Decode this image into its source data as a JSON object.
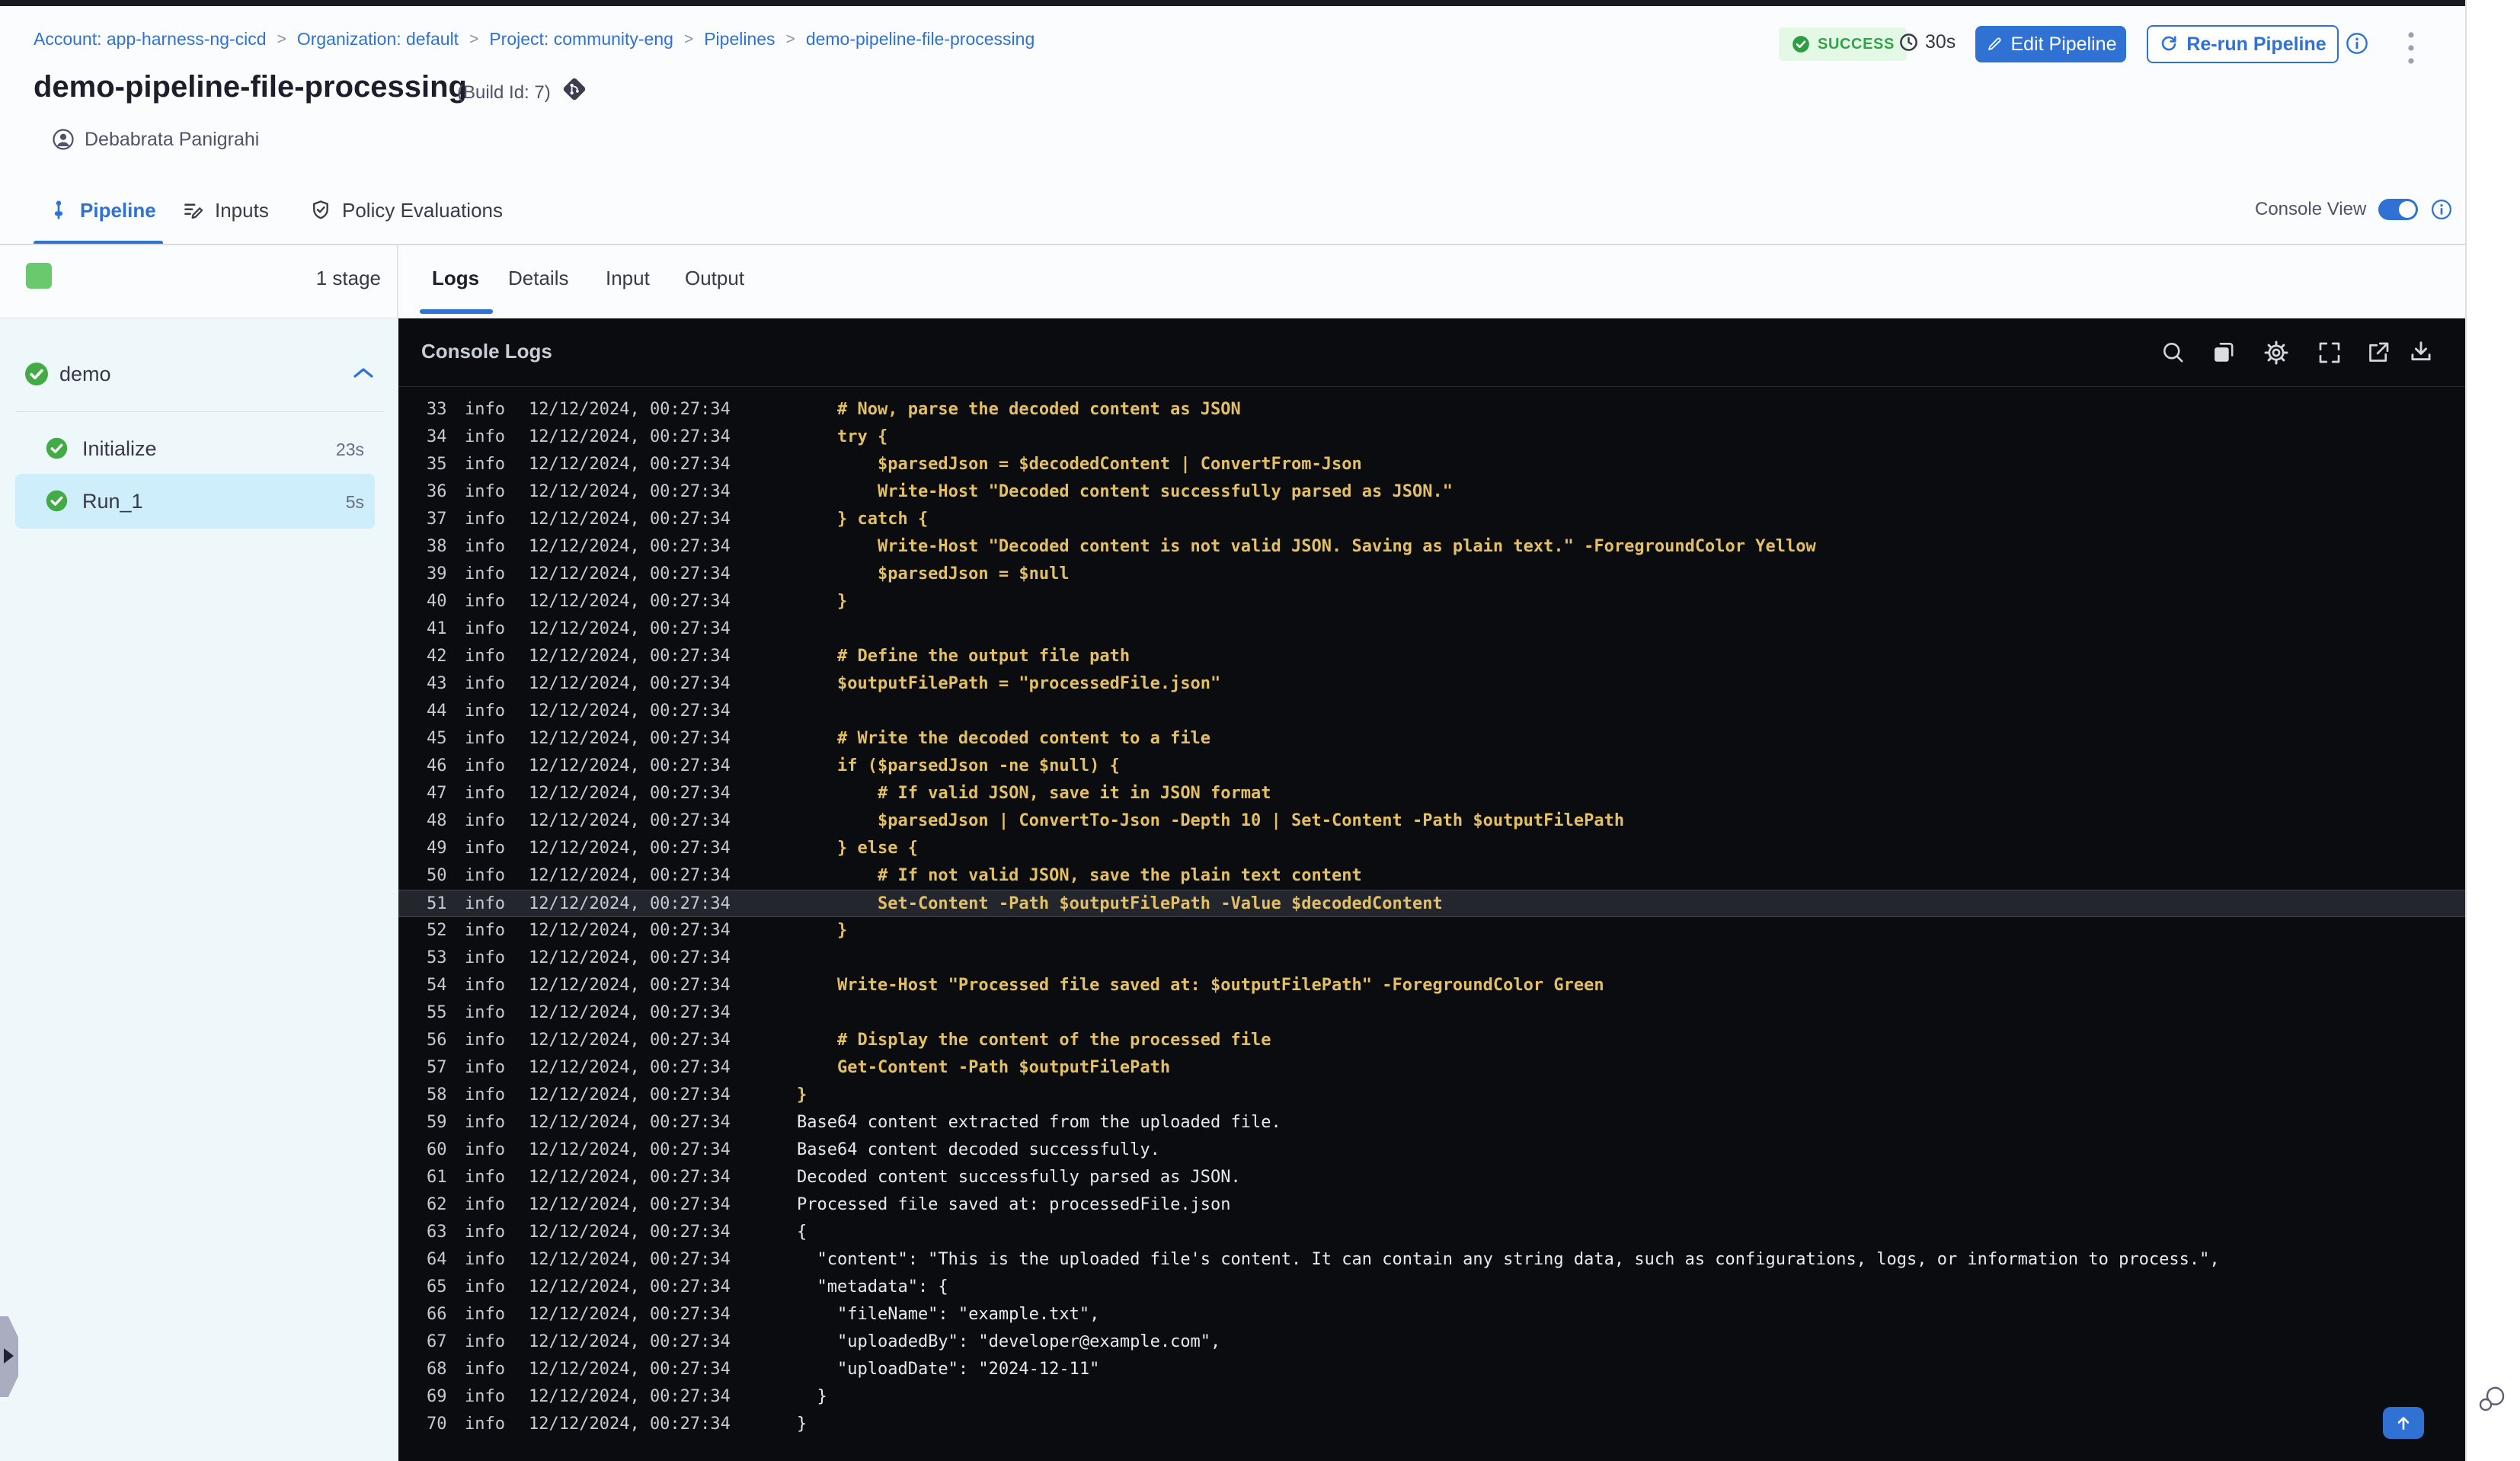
{
  "breadcrumb": {
    "separator": ">",
    "items": [
      "Account: app-harness-ng-cicd",
      "Organization: default",
      "Project: community-eng",
      "Pipelines",
      "demo-pipeline-file-processing"
    ]
  },
  "header": {
    "title": "demo-pipeline-file-processing",
    "build_id": "(Build Id: 7)",
    "author": "Debabrata Panigrahi",
    "status": "SUCCESS",
    "duration": "30s",
    "edit_button": "Edit Pipeline",
    "rerun_button": "Re-run Pipeline"
  },
  "tabs": {
    "items": [
      {
        "label": "Pipeline"
      },
      {
        "label": "Inputs"
      },
      {
        "label": "Policy Evaluations"
      }
    ],
    "console_view_label": "Console View",
    "console_view_on": true
  },
  "sidebar": {
    "stage_count": "1 stage",
    "stage": {
      "name": "demo",
      "status": "success"
    },
    "steps": [
      {
        "name": "Initialize",
        "duration": "23s",
        "status": "success",
        "selected": false
      },
      {
        "name": "Run_1",
        "duration": "5s",
        "status": "success",
        "selected": true
      }
    ]
  },
  "console": {
    "title": "Console Logs",
    "tabs": [
      {
        "label": "Logs"
      },
      {
        "label": "Details"
      },
      {
        "label": "Input"
      },
      {
        "label": "Output"
      }
    ],
    "toolbar_icons": [
      "search",
      "copy",
      "settings",
      "fullscreen",
      "open-in-new",
      "download"
    ],
    "colors": {
      "script_text": "#e3bf66",
      "output_text": "#e7e9ed",
      "meta_text": "#c6cbd3",
      "background": "#0b0c0f",
      "highlight_row": "#23262c"
    },
    "logs": [
      {
        "n": "33",
        "level": "info",
        "ts": "12/12/2024, 00:27:34",
        "tone": "script",
        "text": "    # Now, parse the decoded content as JSON"
      },
      {
        "n": "34",
        "level": "info",
        "ts": "12/12/2024, 00:27:34",
        "tone": "script",
        "text": "    try {"
      },
      {
        "n": "35",
        "level": "info",
        "ts": "12/12/2024, 00:27:34",
        "tone": "script",
        "text": "        $parsedJson = $decodedContent | ConvertFrom-Json"
      },
      {
        "n": "36",
        "level": "info",
        "ts": "12/12/2024, 00:27:34",
        "tone": "script",
        "text": "        Write-Host \"Decoded content successfully parsed as JSON.\""
      },
      {
        "n": "37",
        "level": "info",
        "ts": "12/12/2024, 00:27:34",
        "tone": "script",
        "text": "    } catch {"
      },
      {
        "n": "38",
        "level": "info",
        "ts": "12/12/2024, 00:27:34",
        "tone": "script",
        "text": "        Write-Host \"Decoded content is not valid JSON. Saving as plain text.\" -ForegroundColor Yellow"
      },
      {
        "n": "39",
        "level": "info",
        "ts": "12/12/2024, 00:27:34",
        "tone": "script",
        "text": "        $parsedJson = $null"
      },
      {
        "n": "40",
        "level": "info",
        "ts": "12/12/2024, 00:27:34",
        "tone": "script",
        "text": "    }"
      },
      {
        "n": "41",
        "level": "info",
        "ts": "12/12/2024, 00:27:34",
        "tone": "script",
        "text": ""
      },
      {
        "n": "42",
        "level": "info",
        "ts": "12/12/2024, 00:27:34",
        "tone": "script",
        "text": "    # Define the output file path"
      },
      {
        "n": "43",
        "level": "info",
        "ts": "12/12/2024, 00:27:34",
        "tone": "script",
        "text": "    $outputFilePath = \"processedFile.json\""
      },
      {
        "n": "44",
        "level": "info",
        "ts": "12/12/2024, 00:27:34",
        "tone": "script",
        "text": ""
      },
      {
        "n": "45",
        "level": "info",
        "ts": "12/12/2024, 00:27:34",
        "tone": "script",
        "text": "    # Write the decoded content to a file"
      },
      {
        "n": "46",
        "level": "info",
        "ts": "12/12/2024, 00:27:34",
        "tone": "script",
        "text": "    if ($parsedJson -ne $null) {"
      },
      {
        "n": "47",
        "level": "info",
        "ts": "12/12/2024, 00:27:34",
        "tone": "script",
        "text": "        # If valid JSON, save it in JSON format"
      },
      {
        "n": "48",
        "level": "info",
        "ts": "12/12/2024, 00:27:34",
        "tone": "script",
        "text": "        $parsedJson | ConvertTo-Json -Depth 10 | Set-Content -Path $outputFilePath"
      },
      {
        "n": "49",
        "level": "info",
        "ts": "12/12/2024, 00:27:34",
        "tone": "script",
        "text": "    } else {"
      },
      {
        "n": "50",
        "level": "info",
        "ts": "12/12/2024, 00:27:34",
        "tone": "script",
        "text": "        # If not valid JSON, save the plain text content"
      },
      {
        "n": "51",
        "level": "info",
        "ts": "12/12/2024, 00:27:34",
        "tone": "script",
        "highlight": true,
        "text": "        Set-Content -Path $outputFilePath -Value $decodedContent"
      },
      {
        "n": "52",
        "level": "info",
        "ts": "12/12/2024, 00:27:34",
        "tone": "script",
        "text": "    }"
      },
      {
        "n": "53",
        "level": "info",
        "ts": "12/12/2024, 00:27:34",
        "tone": "script",
        "text": ""
      },
      {
        "n": "54",
        "level": "info",
        "ts": "12/12/2024, 00:27:34",
        "tone": "script",
        "text": "    Write-Host \"Processed file saved at: $outputFilePath\" -ForegroundColor Green"
      },
      {
        "n": "55",
        "level": "info",
        "ts": "12/12/2024, 00:27:34",
        "tone": "script",
        "text": ""
      },
      {
        "n": "56",
        "level": "info",
        "ts": "12/12/2024, 00:27:34",
        "tone": "script",
        "text": "    # Display the content of the processed file"
      },
      {
        "n": "57",
        "level": "info",
        "ts": "12/12/2024, 00:27:34",
        "tone": "script",
        "text": "    Get-Content -Path $outputFilePath"
      },
      {
        "n": "58",
        "level": "info",
        "ts": "12/12/2024, 00:27:34",
        "tone": "script",
        "text": "}"
      },
      {
        "n": "59",
        "level": "info",
        "ts": "12/12/2024, 00:27:34",
        "tone": "output",
        "text": "Base64 content extracted from the uploaded file."
      },
      {
        "n": "60",
        "level": "info",
        "ts": "12/12/2024, 00:27:34",
        "tone": "output",
        "text": "Base64 content decoded successfully."
      },
      {
        "n": "61",
        "level": "info",
        "ts": "12/12/2024, 00:27:34",
        "tone": "output",
        "text": "Decoded content successfully parsed as JSON."
      },
      {
        "n": "62",
        "level": "info",
        "ts": "12/12/2024, 00:27:34",
        "tone": "output",
        "text": "Processed file saved at: processedFile.json"
      },
      {
        "n": "63",
        "level": "info",
        "ts": "12/12/2024, 00:27:34",
        "tone": "output",
        "text": "{"
      },
      {
        "n": "64",
        "level": "info",
        "ts": "12/12/2024, 00:27:34",
        "tone": "output",
        "text": "  \"content\": \"This is the uploaded file's content. It can contain any string data, such as configurations, logs, or information to process.\","
      },
      {
        "n": "65",
        "level": "info",
        "ts": "12/12/2024, 00:27:34",
        "tone": "output",
        "text": "  \"metadata\": {"
      },
      {
        "n": "66",
        "level": "info",
        "ts": "12/12/2024, 00:27:34",
        "tone": "output",
        "text": "    \"fileName\": \"example.txt\","
      },
      {
        "n": "67",
        "level": "info",
        "ts": "12/12/2024, 00:27:34",
        "tone": "output",
        "text": "    \"uploadedBy\": \"developer@example.com\","
      },
      {
        "n": "68",
        "level": "info",
        "ts": "12/12/2024, 00:27:34",
        "tone": "output",
        "text": "    \"uploadDate\": \"2024-12-11\""
      },
      {
        "n": "69",
        "level": "info",
        "ts": "12/12/2024, 00:27:34",
        "tone": "output",
        "text": "  }"
      },
      {
        "n": "70",
        "level": "info",
        "ts": "12/12/2024, 00:27:34",
        "tone": "output",
        "text": "}"
      }
    ]
  },
  "colors": {
    "accent_blue": "#2f72d3",
    "success_green": "#42ab45",
    "badge_bg": "#e3f8e5",
    "sidebar_bg": "#eef7f9",
    "selected_step_bg": "#cfeefb",
    "console_bg": "#0b0c0f"
  }
}
